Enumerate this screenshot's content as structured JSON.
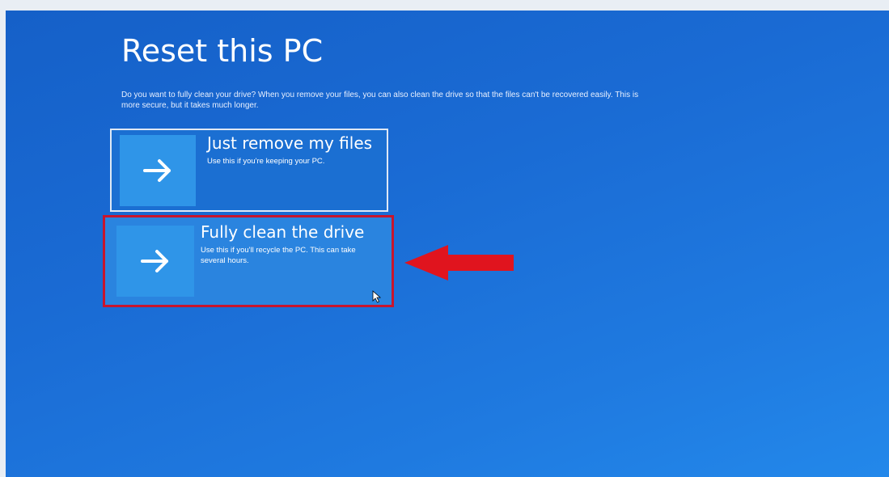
{
  "page": {
    "title": "Reset this PC",
    "description": "Do you want to fully clean your drive? When you remove your files, you can also clean the drive so that the files can't be recovered easily. This is more secure, but it takes much longer."
  },
  "options": [
    {
      "title": "Just remove my files",
      "description": "Use this if you're keeping your PC.",
      "icon": "arrow-right-icon"
    },
    {
      "title": "Fully clean the drive",
      "description": "Use this if you'll recycle the PC. This can take several hours.",
      "icon": "arrow-right-icon",
      "highlighted": true
    }
  ],
  "annotation": {
    "icon": "red-arrow-left-icon",
    "color": "#e0141e"
  },
  "colors": {
    "background": "#1a6bd4",
    "tile": "#2f95e8",
    "highlight_border": "#c8152d"
  }
}
